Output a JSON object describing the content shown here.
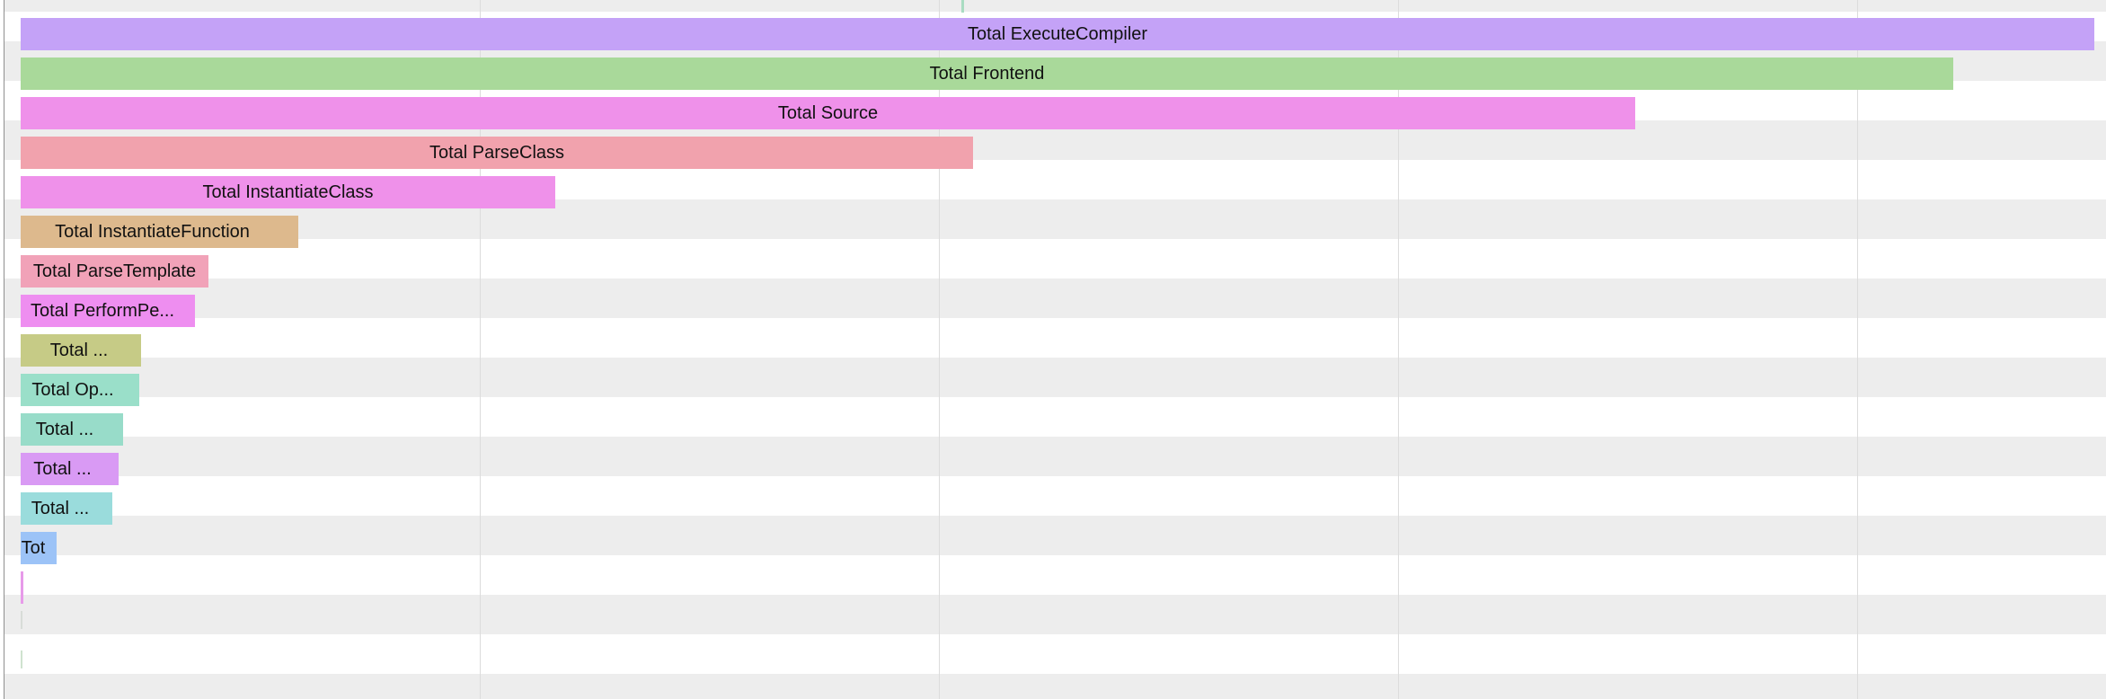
{
  "colors": {
    "row_alt_background": "#ededed",
    "gridline": "#dcdcdc",
    "window_border": "#8f8f8f"
  },
  "timeline": {
    "bars": [
      {
        "label": "Total ExecuteCompiler",
        "color": "#c4a2f7"
      },
      {
        "label": "Total Frontend",
        "color": "#a9d99a"
      },
      {
        "label": "Total Source",
        "color": "#ef91ea"
      },
      {
        "label": "Total ParseClass",
        "color": "#f1a2ad"
      },
      {
        "label": "Total InstantiateClass",
        "color": "#ef91ea"
      },
      {
        "label": "Total InstantiateFunction",
        "color": "#ddb98d"
      },
      {
        "label": "Total ParseTemplate",
        "color": "#f1a2b8"
      },
      {
        "label": "Total PerformPe...",
        "color": "#ee8ef0"
      },
      {
        "label": "Total ...",
        "color": "#c6cb86"
      },
      {
        "label": "Total Op...",
        "color": "#9adfc9"
      },
      {
        "label": "Total ...",
        "color": "#98dcc9"
      },
      {
        "label": "Total ...",
        "color": "#d99af4"
      },
      {
        "label": "Total ...",
        "color": "#9adcdc"
      },
      {
        "label": "Tot",
        "color": "#9cc3f7"
      },
      {
        "label": "",
        "color": "#e79be9"
      },
      {
        "label": "",
        "color": "#d8dcd8"
      },
      {
        "label": "",
        "color": "#cfe3cf"
      }
    ]
  }
}
